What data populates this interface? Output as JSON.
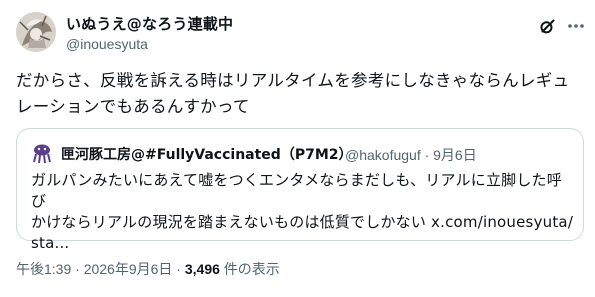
{
  "author": {
    "display_name": "いぬうえ@なろう連載中",
    "handle": "@inouesyuta"
  },
  "actions": {
    "grok_icon": "grok-icon",
    "more_icon": "more-icon"
  },
  "tweet": {
    "text_line1": "だからさ、反戦を訴える時はリアルタイムを参考にしなきゃならんレギュ",
    "text_line2": "レーションでもあるんすかって"
  },
  "quote": {
    "display_name": "匣河豚工房@#FullyVaccinated（P7M2）",
    "handle_date": "@hakofuguf · 9月6日",
    "text_line1": "ガルパンみたいにあえて嘘をつくエンタメならまだしも、リアルに立脚した呼び",
    "text_line2_prefix": "かけならリアルの現況を踏まえないものは低質でしかない ",
    "link": "x.com/inouesyuta/",
    "text_line3": "sta..."
  },
  "meta": {
    "timestamp": "午後1:39 · 2026年9月6日 · ",
    "views": "3,496",
    "views_suffix": " 件の表示"
  },
  "colors": {
    "text": "#0f1419",
    "secondary": "#536471",
    "border": "#cfd9de"
  }
}
